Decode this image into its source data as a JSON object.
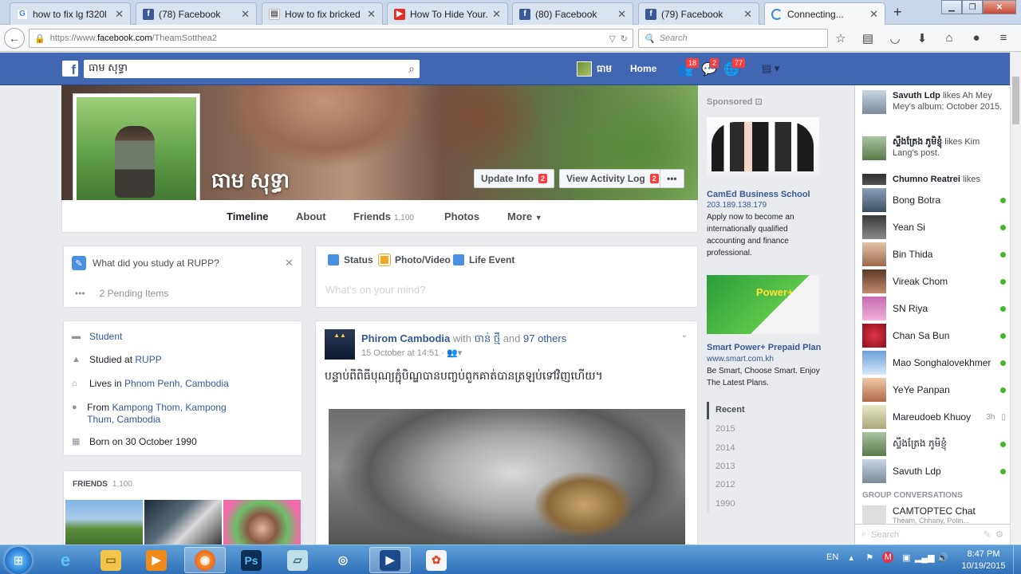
{
  "browser": {
    "tabs": [
      {
        "label": "how to fix lg f320l ...",
        "favicon": "google-icon",
        "active": false
      },
      {
        "label": "(78) Facebook",
        "favicon": "facebook-icon",
        "active": false
      },
      {
        "label": "How to fix bricked ...",
        "favicon": "web-icon",
        "active": false
      },
      {
        "label": "How To Hide Your...",
        "favicon": "youtube-icon",
        "active": false
      },
      {
        "label": "(80) Facebook",
        "favicon": "facebook-icon",
        "active": false
      },
      {
        "label": "(79) Facebook",
        "favicon": "facebook-icon",
        "active": false
      },
      {
        "label": "Connecting...",
        "favicon": "loading-icon",
        "active": true
      }
    ],
    "url_prefix": "https://www.",
    "url_domain": "facebook.com",
    "url_path": "/TheamSotthea2",
    "search_placeholder": "Search"
  },
  "fb": {
    "search_value": "ធាម សុទ្ធា",
    "user_name": "ធាម",
    "home_label": "Home",
    "friend_requests_count": "18",
    "messages_count": "2",
    "notifications_count": "77"
  },
  "profile": {
    "name": "ធាម សុទ្ធា",
    "update_info_label": "Update Info",
    "update_info_badge": "2",
    "activity_log_label": "View Activity Log",
    "activity_log_badge": "2",
    "more_dots": "•••",
    "tabs": {
      "timeline": "Timeline",
      "about": "About",
      "friends": "Friends",
      "friends_count": "1,100",
      "photos": "Photos",
      "more": "More"
    }
  },
  "ask": {
    "question": "What did you study at RUPP?",
    "pending_dots": "•••",
    "pending_label": "2 Pending Items"
  },
  "about": {
    "work": "Student",
    "studied_prefix": "Studied at ",
    "studied_link": "RUPP",
    "lives_prefix": "Lives in ",
    "lives_link": "Phnom Penh, Cambodia",
    "from_prefix": "From ",
    "from_link": "Kampong Thom, Kampong Thum, Cambodia",
    "born": "Born on 30 October 1990"
  },
  "friends_card": {
    "title": "FRIENDS",
    "count": "1,100"
  },
  "composer": {
    "status": "Status",
    "photo_video": "Photo/Video",
    "life_event": "Life Event",
    "placeholder": "What's on your mind?"
  },
  "post": {
    "author": "Phirom Cambodia",
    "with_word": " with ",
    "tagged": "ចាន់ ថ្មី",
    "and_word": " and ",
    "others": "97 others",
    "time": "15 October at 14:51",
    "text": "បន្ទាប់ពីពិធីបុណ្យភ្ជុំបិណ្ឌបានបញ្ចប់ពួកគាត់បានត្រឡប់ទៅវិញហើយ។"
  },
  "ads": {
    "sponsored": "Sponsored",
    "ad1": {
      "title": "CamEd Business School",
      "url": "203.189.138.179",
      "desc": "Apply now to become an internationally qualified accounting and finance professional."
    },
    "ad2": {
      "image_text": "Power+",
      "title": "Smart Power+ Prepaid Plan",
      "url": "www.smart.com.kh",
      "desc": "Be Smart, Choose Smart. Enjoy The Latest Plans."
    }
  },
  "years": [
    "Recent",
    "2015",
    "2014",
    "2013",
    "2012",
    "1990"
  ],
  "ticker": [
    {
      "name": "Savuth Ldp",
      "action": " likes Ah Mey Mey's album: October 2015."
    },
    {
      "name": "ស្ទឹងត្រែង ភូមិខ្ញុំ",
      "action": " likes Kim Lang's post."
    },
    {
      "name": "Chumno Reatrei",
      "action": " likes"
    }
  ],
  "chat": [
    {
      "name": "Bong Botra",
      "status": "online"
    },
    {
      "name": "Yean Si",
      "status": "online"
    },
    {
      "name": "Bin Thida",
      "status": "online"
    },
    {
      "name": "Vireak Chom",
      "status": "online"
    },
    {
      "name": "SN Riya",
      "status": "online"
    },
    {
      "name": "Chan Sa Bun",
      "status": "online"
    },
    {
      "name": "Mao Songhalovekhmer",
      "status": "online"
    },
    {
      "name": "YeYe Panpan",
      "status": "online"
    },
    {
      "name": "Mareudoeb Khuoy",
      "status": "3h"
    },
    {
      "name": "ស្ទឹងត្រែង ភូមិខ្ញុំ",
      "status": "online"
    },
    {
      "name": "Savuth Ldp",
      "status": "online"
    }
  ],
  "group": {
    "heading": "GROUP CONVERSATIONS",
    "name": "CAMTOPTEC Chat",
    "sub": "Theam, Chhany, Polin..."
  },
  "chat_search_placeholder": "Search",
  "taskbar": {
    "lang": "EN",
    "time": "8:47 PM",
    "date": "10/19/2015"
  },
  "colors": {
    "fb_blue": "#4267b2",
    "link": "#365899",
    "online": "#42b72a",
    "badge": "#fa3e3e"
  }
}
